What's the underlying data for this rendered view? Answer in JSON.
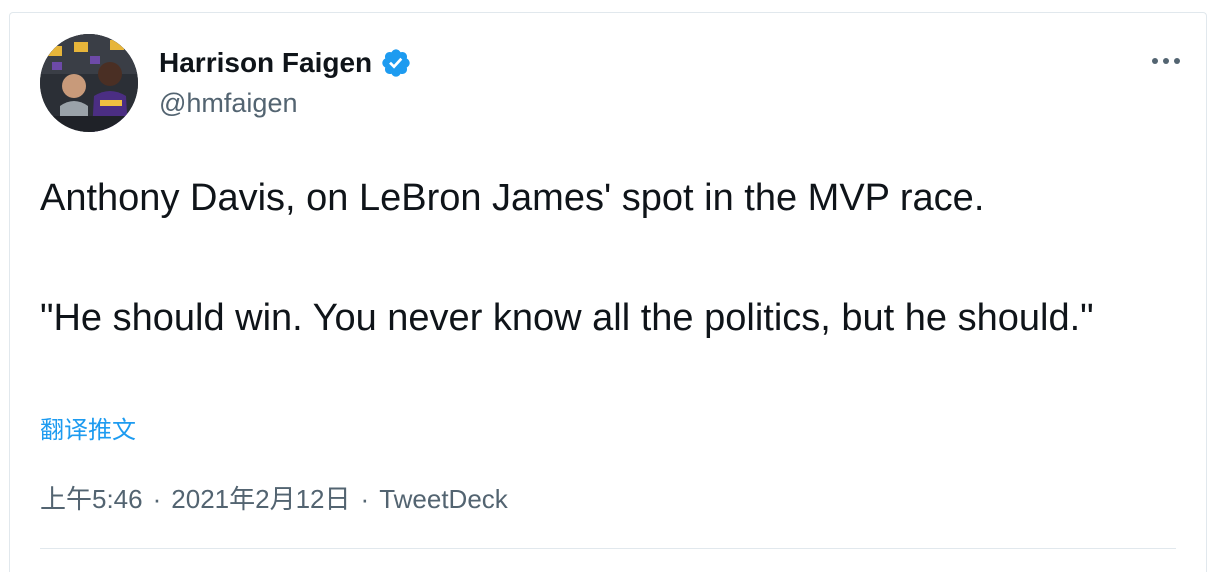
{
  "author": {
    "display_name": "Harrison Faigen",
    "handle": "@hmfaigen",
    "verified": true,
    "avatar_icon": "profile-photo"
  },
  "menu": {
    "icon": "more-horizontal-icon"
  },
  "tweet": {
    "text": "Anthony Davis, on LeBron James' spot in the MVP race.\n\n\"He should win. You never know all the politics, but he should.\""
  },
  "translate_link": "翻译推文",
  "meta": {
    "time": "上午5:46",
    "separator": "·",
    "date": "2021年2月12日",
    "source": "TweetDeck"
  },
  "colors": {
    "text": "#0f1419",
    "secondary": "#536471",
    "link": "#1d9bf0",
    "verified": "#1d9bf0",
    "border": "#e1e8ed"
  }
}
